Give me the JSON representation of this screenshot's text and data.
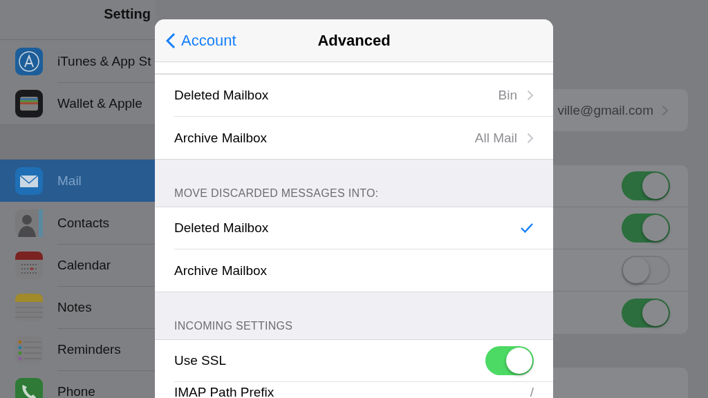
{
  "sidebar": {
    "title": "Setting",
    "groups": [
      {
        "items": [
          {
            "kind": "appstore",
            "label": "iTunes & App St",
            "selected": false
          },
          {
            "kind": "wallet",
            "label": "Wallet & Apple",
            "selected": false
          }
        ]
      },
      {
        "items": [
          {
            "kind": "mail",
            "label": "Mail",
            "selected": true
          },
          {
            "kind": "contacts",
            "label": "Contacts",
            "selected": false
          },
          {
            "kind": "calendar",
            "label": "Calendar",
            "selected": false
          },
          {
            "kind": "notes",
            "label": "Notes",
            "selected": false
          },
          {
            "kind": "reminders",
            "label": "Reminders",
            "selected": false
          },
          {
            "kind": "phone",
            "label": "Phone",
            "selected": false
          }
        ]
      }
    ]
  },
  "account_pane": {
    "account_value": "ville@gmail.com",
    "toggles": [
      {
        "on": true
      },
      {
        "on": true
      },
      {
        "on": false
      },
      {
        "on": true
      }
    ]
  },
  "modal": {
    "back": "Account",
    "title": "Advanced",
    "sections": [
      {
        "rows": [
          {
            "kind": "disclosure",
            "label": "Deleted Mailbox",
            "value": "Bin"
          },
          {
            "kind": "disclosure",
            "label": "Archive Mailbox",
            "value": "All Mail"
          }
        ]
      },
      {
        "header": "MOVE DISCARDED MESSAGES INTO:",
        "rows": [
          {
            "kind": "choice",
            "label": "Deleted Mailbox",
            "selected": true
          },
          {
            "kind": "choice",
            "label": "Archive Mailbox",
            "selected": false
          }
        ]
      },
      {
        "header": "INCOMING SETTINGS",
        "rows": [
          {
            "kind": "switch",
            "label": "Use SSL",
            "on": true
          },
          {
            "kind": "value",
            "label": "IMAP Path Prefix",
            "value": "/"
          }
        ]
      }
    ]
  }
}
